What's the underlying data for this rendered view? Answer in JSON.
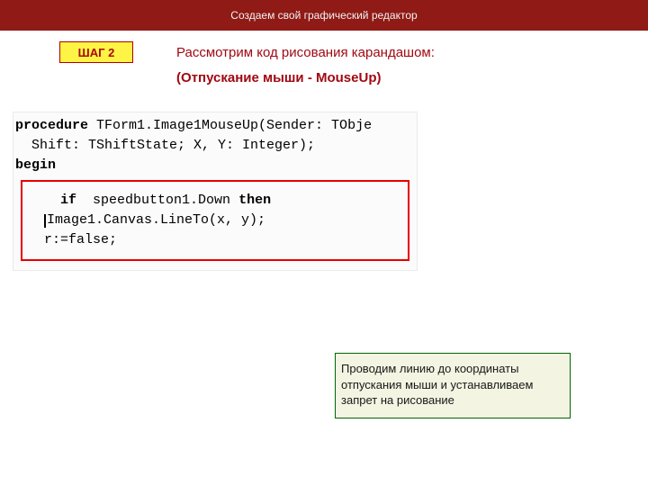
{
  "header": {
    "title": "Создаем свой графический редактор"
  },
  "step": {
    "label": "ШАГ 2"
  },
  "headline": {
    "main": "Рассмотрим код рисования карандашом:",
    "sub": "(Отпускание мыши - MouseUp)"
  },
  "code": {
    "sig1a": "procedure",
    "sig1b": " TForm1.Image1MouseUp(Sender: TObje",
    "sig2": "  Shift: TShiftState; X, Y: Integer);",
    "begin": "begin",
    "if_kw": "if",
    "if_mid": "  speedbutton1.Down ",
    "then_kw": "then",
    "l2": "Image1.Canvas.LineTo(x, y);",
    "l3": "r:=false;"
  },
  "note": {
    "text": " Проводим линию до координаты отпускания мыши и устанавливаем запрет на рисование"
  }
}
